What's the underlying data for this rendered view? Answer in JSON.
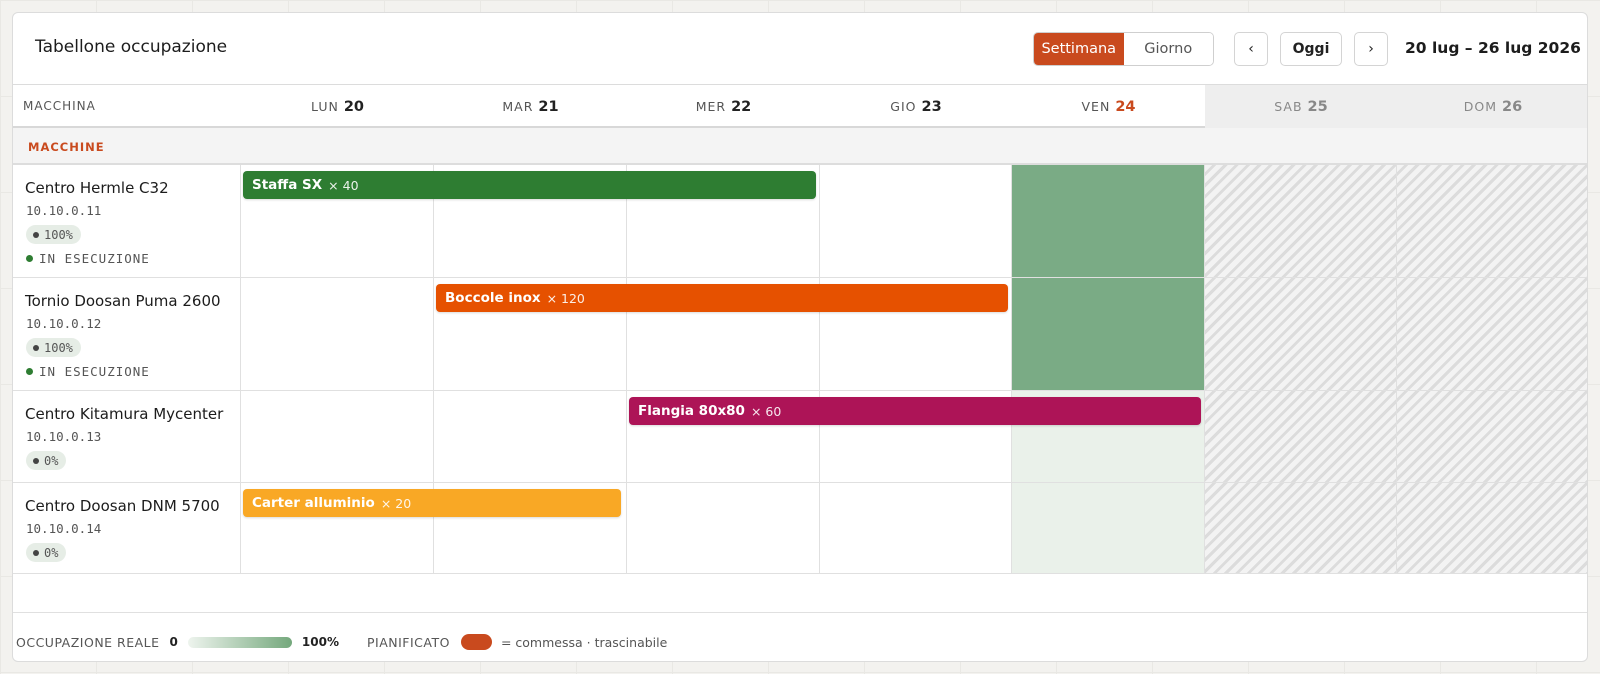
{
  "header": {
    "title": "Tabellone occupazione",
    "view_week": "Settimana",
    "view_day": "Giorno",
    "prev_label": "‹",
    "today_label": "Oggi",
    "next_label": "›",
    "date_range": "20 lug – 26 lug 2026"
  },
  "grid": {
    "machine_col_header": "MACCHINA",
    "days": [
      {
        "name": "LUN",
        "num": "20"
      },
      {
        "name": "MAR",
        "num": "21"
      },
      {
        "name": "MER",
        "num": "22"
      },
      {
        "name": "GIO",
        "num": "23"
      },
      {
        "name": "VEN",
        "num": "24",
        "today": true
      },
      {
        "name": "SAB",
        "num": "25",
        "weekend": true
      },
      {
        "name": "DOM",
        "num": "26",
        "weekend": true
      }
    ],
    "group_label": "MACCHINE"
  },
  "machines": [
    {
      "name": "Centro Hermle C32",
      "ip": "10.10.0.11",
      "utilization": "100%",
      "status": "IN ESECUZIONE"
    },
    {
      "name": "Tornio Doosan Puma 2600",
      "ip": "10.10.0.12",
      "utilization": "100%",
      "status": "IN ESECUZIONE"
    },
    {
      "name": "Centro Kitamura Mycenter",
      "ip": "10.10.0.13",
      "utilization": "0%",
      "status": ""
    },
    {
      "name": "Centro Doosan DNM 5700",
      "ip": "10.10.0.14",
      "utilization": "0%",
      "status": ""
    }
  ],
  "jobs": [
    {
      "name": "Staffa SX",
      "qty": "× 40",
      "color": "#2e7d32"
    },
    {
      "name": "Boccole inox",
      "qty": "× 120",
      "color": "#e65100"
    },
    {
      "name": "Flangia 80x80",
      "qty": "× 60",
      "color": "#ad1457"
    },
    {
      "name": "Carter alluminio",
      "qty": "× 20",
      "color": "#f9a825"
    }
  ],
  "legend": {
    "real_label": "OCCUPAZIONE REALE",
    "min": "0",
    "max": "100%",
    "planned_label": "PIANIFICATO",
    "planned_note": "= commessa · trascinabile",
    "accent": "#c94a1e"
  }
}
